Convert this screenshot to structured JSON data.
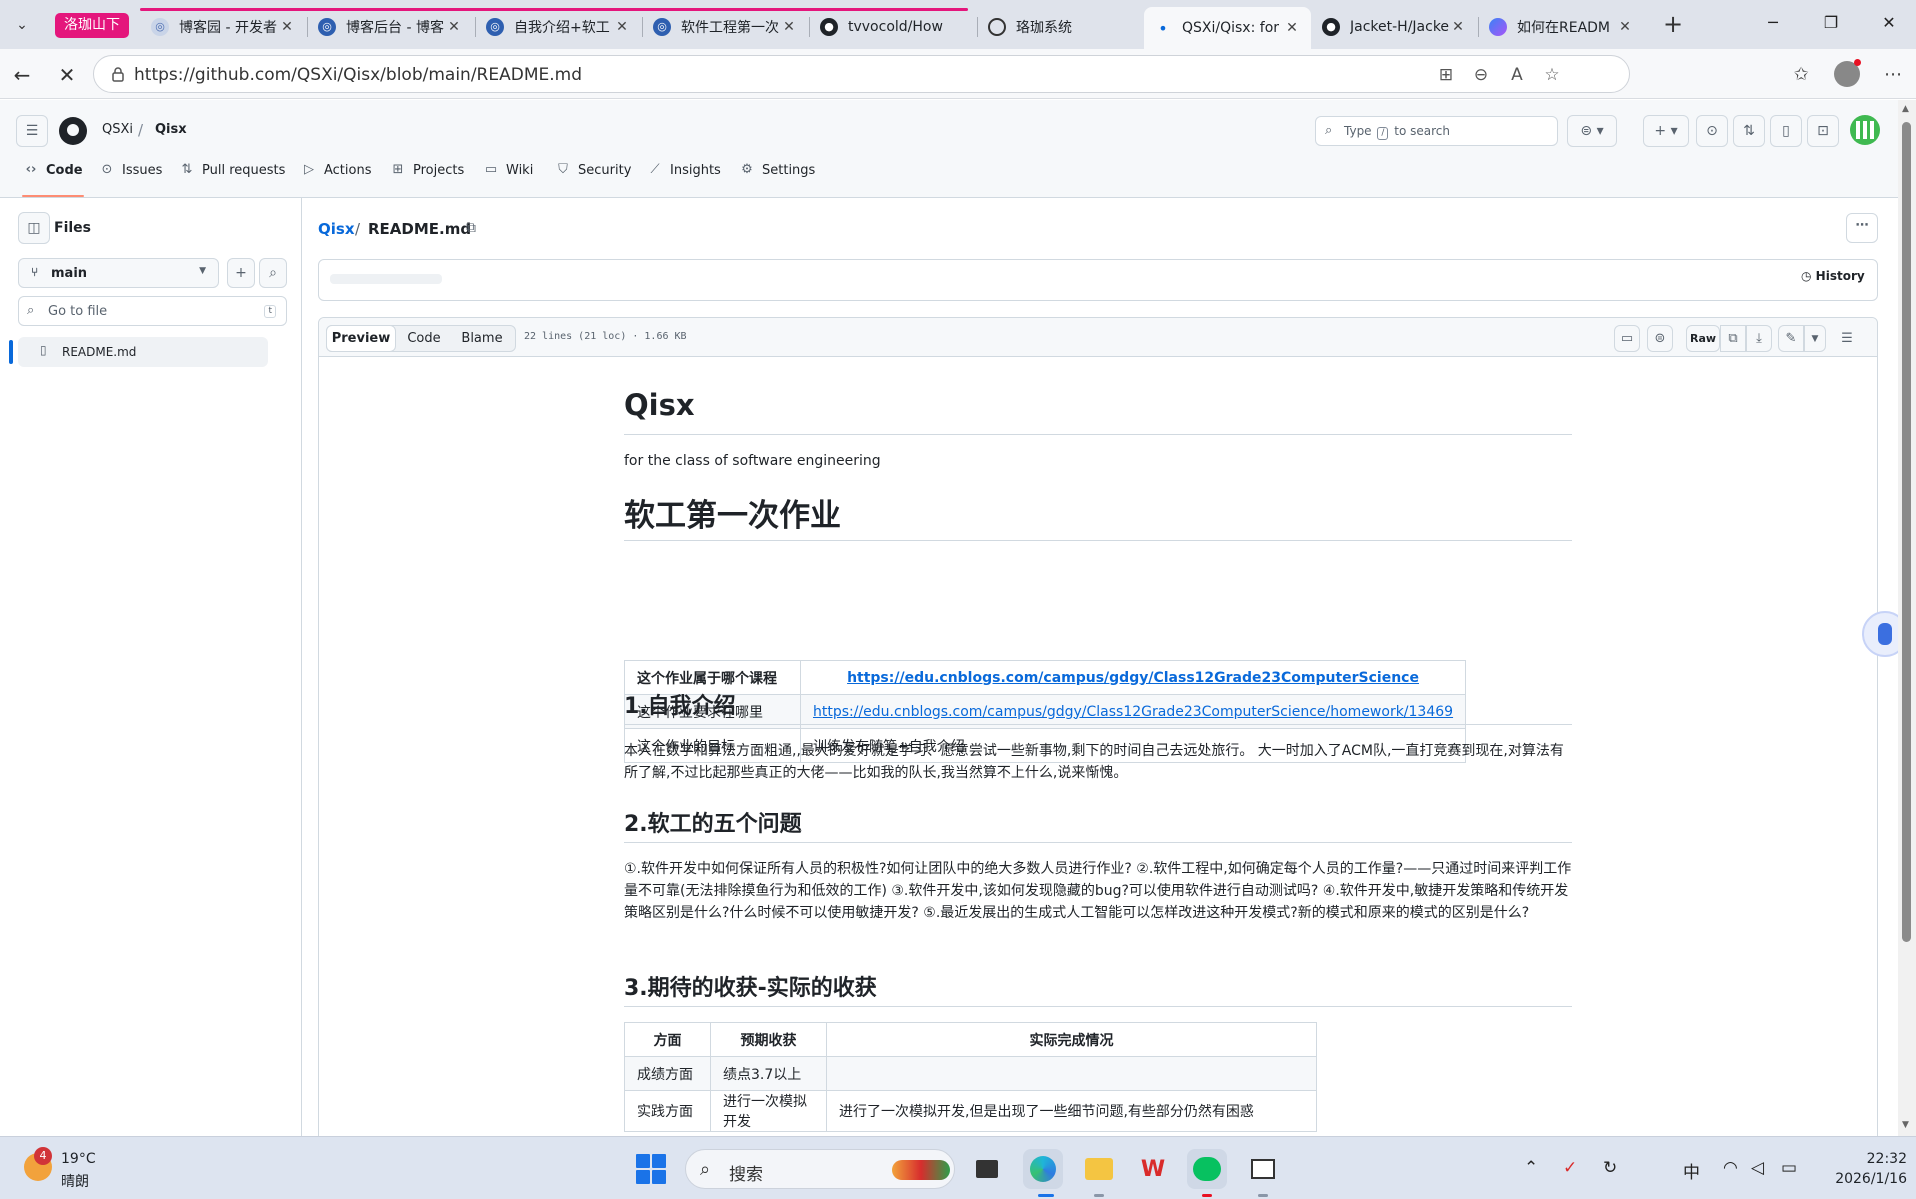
{
  "browser": {
    "tab_group_label": "洛珈山下",
    "tabs": [
      {
        "title": "博客园 - 开发者",
        "favicon": "cnblogs-icon"
      },
      {
        "title": "博客后台 - 博客",
        "favicon": "cnblogs-icon"
      },
      {
        "title": "自我介绍+软工",
        "favicon": "cnblogs-icon"
      },
      {
        "title": "软件工程第一次",
        "favicon": "cnblogs-icon"
      },
      {
        "title": "tvvocold/How",
        "favicon": "github-icon"
      },
      {
        "title": "珞珈系统",
        "favicon": "globe-icon"
      },
      {
        "title": "QSXi/Qisx: for",
        "favicon": "loading-icon",
        "active": true
      },
      {
        "title": "Jacket-H/Jacke",
        "favicon": "github-icon"
      },
      {
        "title": "如何在READM",
        "favicon": "copilot-icon"
      }
    ],
    "url": "https://github.com/QSXi/Qisx/blob/main/README.md"
  },
  "github": {
    "owner": "QSXi",
    "repo": "Qisx",
    "search_placeholder_pre": "Type",
    "search_placeholder_key": "/",
    "search_placeholder_post": "to search",
    "nav": [
      {
        "label": "Code",
        "icon": "code-icon"
      },
      {
        "label": "Issues",
        "icon": "issue-icon"
      },
      {
        "label": "Pull requests",
        "icon": "pull-request-icon"
      },
      {
        "label": "Actions",
        "icon": "actions-icon"
      },
      {
        "label": "Projects",
        "icon": "projects-icon"
      },
      {
        "label": "Wiki",
        "icon": "book-icon"
      },
      {
        "label": "Security",
        "icon": "shield-icon"
      },
      {
        "label": "Insights",
        "icon": "graph-icon"
      },
      {
        "label": "Settings",
        "icon": "gear-icon"
      }
    ]
  },
  "sidebar": {
    "title": "Files",
    "branch": "main",
    "goto_placeholder": "Go to file",
    "goto_key": "t",
    "tree": [
      {
        "name": "README.md",
        "selected": true
      }
    ]
  },
  "file": {
    "repo_crumb": "Qisx",
    "name": "README.md",
    "history_label": "History",
    "view_tabs": [
      "Preview",
      "Code",
      "Blame"
    ],
    "meta": "22 lines (21 loc) · 1.66 KB",
    "raw_label": "Raw"
  },
  "readme": {
    "title": "Qisx",
    "description": "for the class of software engineering",
    "heading": "软工第一次作业",
    "info_table": [
      {
        "key": "这个作业属于哪个课程",
        "value": "https://edu.cnblogs.com/campus/gdgy/Class12Grade23ComputerScience",
        "link": true
      },
      {
        "key": "这个作业要求在哪里",
        "value": "https://edu.cnblogs.com/campus/gdgy/Class12Grade23ComputerScience/homework/13469",
        "link": true
      },
      {
        "key": "这个作业的目标",
        "value": "训练发布随笔+自我介绍",
        "link": false
      }
    ],
    "sections": [
      {
        "heading": "1.自我介绍",
        "body": "本人在数学和算法方面粗通,,最大的爱好就是学习、愿意尝试一些新事物,剩下的时间自己去远处旅行。 大一时加入了ACM队,一直打竞赛到现在,对算法有所了解,不过比起那些真正的大佬——比如我的队长,我当然算不上什么,说来惭愧。"
      },
      {
        "heading": "2.软工的五个问题",
        "body": "①.软件开发中如何保证所有人员的积极性?如何让团队中的绝大多数人员进行作业? ②.软件工程中,如何确定每个人员的工作量?——只通过时间来评判工作量不可靠(无法排除摸鱼行为和低效的工作) ③.软件开发中,该如何发现隐藏的bug?可以使用软件进行自动测试吗? ④.软件开发中,敏捷开发策略和传统开发策略区别是什么?什么时候不可以使用敏捷开发? ⑤.最近发展出的生成式人工智能可以怎样改进这种开发模式?新的模式和原来的模式的区别是什么?"
      },
      {
        "heading": "3.期待的收获-实际的收获"
      }
    ],
    "gains_table": {
      "headers": [
        "方面",
        "预期收获",
        "实际完成情况"
      ],
      "rows": [
        [
          "成绩方面",
          "绩点3.7以上",
          ""
        ],
        [
          "实践方面",
          "进行一次模拟开发",
          "进行了一次模拟开发,但是出现了一些细节问题,有些部分仍然有困惑"
        ]
      ]
    }
  },
  "taskbar": {
    "weather_badge": "4",
    "temperature": "19°C",
    "weather": "晴朗",
    "search_placeholder": "搜索",
    "ime": "中",
    "time": "22:32",
    "date": "2026/1/16"
  },
  "colors": {
    "accent": "#0969da",
    "tab_group": "#e4167c",
    "active_tab_underline": "#fd8c73"
  }
}
